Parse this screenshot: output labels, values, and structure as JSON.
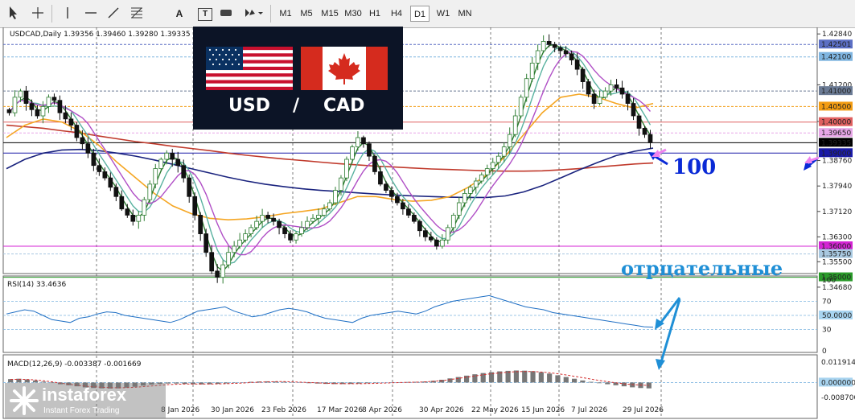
{
  "toolbar": {
    "tools": [
      "cursor-icon",
      "crosshair-icon",
      "vertical-line-icon",
      "horizontal-line-icon",
      "trendline-icon",
      "fibonacci-icon",
      "text-icon",
      "label-icon",
      "shapes-icon",
      "arrows-icon"
    ],
    "text_tool_label": "A",
    "label_tool_label": "T",
    "timeframes": [
      "M1",
      "M5",
      "M15",
      "M30",
      "H1",
      "H4",
      "D1",
      "W1",
      "MN"
    ],
    "active_timeframe": "D1"
  },
  "banner": {
    "base": "USD",
    "separator": "/",
    "quote": "CAD"
  },
  "annotations": {
    "ma_label": "100",
    "rsi_note": "отрцательные"
  },
  "logo": {
    "name": "instaforex",
    "tagline": "Instant Forex Trading"
  },
  "colors": {
    "bull": "#2e7d32",
    "bear": "#111111",
    "accent_blue": "#1f8fd6",
    "arrow_blue": "#0a2ad6",
    "arrow_pink": "#ee82ee"
  },
  "chart_data": [
    {
      "type": "candlestick",
      "title": "USDCAD,Daily  1.39356 1.39460 1.39280 1.39335",
      "symbol": "USDCAD,Daily",
      "last_ohlc": {
        "open": 1.39356,
        "high": 1.3946,
        "low": 1.3928,
        "close": 1.39335
      },
      "ylim": [
        1.346,
        1.43
      ],
      "y_ticks": [
        "1.42840",
        "1.41200",
        "1.40020",
        "1.38760",
        "1.37940",
        "1.37120",
        "1.36300",
        "1.35500",
        "1.34680"
      ],
      "x_tick_labels": [
        "8 Jan 2026",
        "30 Jan 2026",
        "23 Feb 2026",
        "17 Mar 2026",
        "8 Apr 2026",
        "30 Apr 2026",
        "22 May 2026",
        "15 Jun 2026",
        "7 Jul 2026",
        "29 Jul 2026"
      ],
      "horizontal_levels": [
        {
          "price": "1.42501",
          "color": "#5b6fc4"
        },
        {
          "price": "1.42100",
          "color": "#7fb5e0"
        },
        {
          "price": "1.41000",
          "color": "#6b7b95"
        },
        {
          "price": "1.40500",
          "color": "#f39c12"
        },
        {
          "price": "1.40000",
          "color": "#e06060"
        },
        {
          "price": "1.39650",
          "color": "#e7a6e7"
        },
        {
          "price": "1.39335",
          "color": "#000000"
        },
        {
          "price": "1.39000",
          "color": "#1a1aa8"
        },
        {
          "price": "1.36000",
          "color": "#d424d4"
        },
        {
          "price": "1.35750",
          "color": "#a8c8e0"
        },
        {
          "price": "1.35000",
          "color": "#2a9a2a"
        }
      ],
      "close_series": [
        1.403,
        1.408,
        1.41,
        1.406,
        1.404,
        1.402,
        1.405,
        1.408,
        1.407,
        1.403,
        1.401,
        1.399,
        1.395,
        1.393,
        1.39,
        1.386,
        1.384,
        1.382,
        1.379,
        1.376,
        1.372,
        1.37,
        1.368,
        1.37,
        1.375,
        1.38,
        1.385,
        1.388,
        1.39,
        1.388,
        1.386,
        1.382,
        1.376,
        1.37,
        1.364,
        1.358,
        1.352,
        1.35,
        1.354,
        1.358,
        1.36,
        1.362,
        1.364,
        1.366,
        1.368,
        1.37,
        1.369,
        1.368,
        1.366,
        1.364,
        1.362,
        1.364,
        1.366,
        1.368,
        1.369,
        1.37,
        1.372,
        1.374,
        1.378,
        1.382,
        1.388,
        1.392,
        1.395,
        1.393,
        1.389,
        1.384,
        1.38,
        1.378,
        1.376,
        1.374,
        1.372,
        1.37,
        1.368,
        1.365,
        1.363,
        1.362,
        1.36,
        1.362,
        1.366,
        1.37,
        1.374,
        1.377,
        1.379,
        1.381,
        1.383,
        1.385,
        1.387,
        1.389,
        1.392,
        1.396,
        1.402,
        1.408,
        1.414,
        1.419,
        1.423,
        1.426,
        1.425,
        1.424,
        1.423,
        1.422,
        1.42,
        1.417,
        1.413,
        1.409,
        1.406,
        1.408,
        1.41,
        1.412,
        1.411,
        1.409,
        1.406,
        1.402,
        1.398,
        1.396,
        1.3934
      ],
      "moving_averages": [
        {
          "name": "MA200",
          "color": "#c0392b",
          "values": [
            1.399,
            1.3985,
            1.398,
            1.3972,
            1.3965,
            1.3955,
            1.3946,
            1.3937,
            1.393,
            1.3922,
            1.3915,
            1.3908,
            1.39,
            1.3893,
            1.3887,
            1.3881,
            1.3876,
            1.3871,
            1.3866,
            1.3862,
            1.3858,
            1.3855,
            1.3852,
            1.3849,
            1.3847,
            1.3845,
            1.3843,
            1.3842,
            1.3842,
            1.3843,
            1.3846,
            1.385,
            1.3855,
            1.386,
            1.3865,
            1.3868
          ]
        },
        {
          "name": "MA100",
          "color": "#1a237e",
          "values": [
            1.385,
            1.388,
            1.39,
            1.391,
            1.3912,
            1.3908,
            1.39,
            1.389,
            1.3878,
            1.3864,
            1.385,
            1.3836,
            1.3822,
            1.381,
            1.38,
            1.3792,
            1.3785,
            1.378,
            1.3776,
            1.3772,
            1.3768,
            1.3765,
            1.3762,
            1.376,
            1.3758,
            1.3757,
            1.3757,
            1.3762,
            1.3775,
            1.3795,
            1.382,
            1.3846,
            1.387,
            1.3892,
            1.3906,
            1.3916
          ]
        },
        {
          "name": "MA50",
          "color": "#f5a623",
          "values": [
            1.395,
            1.399,
            1.401,
            1.4,
            1.397,
            1.3925,
            1.387,
            1.382,
            1.377,
            1.373,
            1.3705,
            1.369,
            1.3685,
            1.3688,
            1.3695,
            1.3705,
            1.3712,
            1.372,
            1.374,
            1.376,
            1.376,
            1.375,
            1.3745,
            1.3748,
            1.376,
            1.379,
            1.383,
            1.389,
            1.396,
            1.403,
            1.408,
            1.409,
            1.408,
            1.406,
            1.4045,
            1.406
          ]
        }
      ]
    },
    {
      "type": "line",
      "title": "RSI(14) 33.4636",
      "name": "RSI(14)",
      "last_value": 33.4636,
      "ylim": [
        0,
        100
      ],
      "y_ticks": [
        "100",
        "70",
        "50.0000",
        "30",
        "0"
      ],
      "levels": [
        70,
        50,
        30
      ],
      "values": [
        52,
        55,
        58,
        56,
        50,
        44,
        42,
        40,
        46,
        48,
        52,
        55,
        54,
        50,
        48,
        46,
        44,
        42,
        40,
        44,
        50,
        56,
        58,
        60,
        62,
        56,
        52,
        48,
        50,
        54,
        58,
        60,
        58,
        55,
        50,
        46,
        44,
        42,
        40,
        46,
        50,
        52,
        54,
        56,
        54,
        52,
        56,
        62,
        66,
        70,
        72,
        74,
        76,
        78,
        74,
        70,
        66,
        62,
        60,
        58,
        54,
        52,
        50,
        48,
        46,
        44,
        42,
        40,
        38,
        36,
        34,
        33.46
      ]
    },
    {
      "type": "bar",
      "title": "MACD(12,26,9) -0.003387 -0.001669",
      "name": "MACD(12,26,9)",
      "macd": -0.003387,
      "signal": -0.001669,
      "ylim": [
        -0.0087,
        0.0119
      ],
      "y_ticks": [
        "0.011914",
        "0.000000",
        "-0.008700"
      ],
      "histogram": [
        0.002,
        0.0022,
        0.0018,
        0.0012,
        0.0005,
        -0.0003,
        -0.001,
        -0.0016,
        -0.0022,
        -0.0028,
        -0.0032,
        -0.0034,
        -0.0035,
        -0.0034,
        -0.003,
        -0.0025,
        -0.0018,
        -0.0012,
        -0.0008,
        -0.0006,
        -0.0006,
        -0.0008,
        -0.001,
        -0.0011,
        -0.001,
        -0.0008,
        -0.0005,
        -0.0002,
        0.0001,
        0.0004,
        0.0006,
        0.0007,
        0.0006,
        0.0004,
        0.0002,
        -0.0001,
        -0.0004,
        -0.0006,
        -0.0008,
        -0.0009,
        -0.0009,
        -0.0008,
        -0.0006,
        -0.0004,
        -0.0002,
        0.0,
        0.0001,
        0.0002,
        0.0003,
        0.0004,
        0.0006,
        0.001,
        0.0016,
        0.0024,
        0.0032,
        0.004,
        0.0048,
        0.0055,
        0.006,
        0.0065,
        0.0068,
        0.007,
        0.0069,
        0.0066,
        0.006,
        0.0052,
        0.0042,
        0.0032,
        0.0022,
        0.0012,
        0.0004,
        -0.0004,
        -0.001,
        -0.0016,
        -0.0022,
        -0.0028,
        -0.0032,
        -0.0034
      ],
      "signal_line": [
        0.0018,
        0.0019,
        0.0018,
        0.0015,
        0.001,
        0.0004,
        -0.0003,
        -0.001,
        -0.0016,
        -0.0021,
        -0.0025,
        -0.0028,
        -0.003,
        -0.0031,
        -0.003,
        -0.0028,
        -0.0024,
        -0.002,
        -0.0016,
        -0.0012,
        -0.001,
        -0.0009,
        -0.0009,
        -0.0009,
        -0.0009,
        -0.0008,
        -0.0007,
        -0.0005,
        -0.0003,
        0.0,
        0.0002,
        0.0004,
        0.0005,
        0.0005,
        0.0004,
        0.0002,
        0.0,
        -0.0002,
        -0.0004,
        -0.0006,
        -0.0007,
        -0.0007,
        -0.0007,
        -0.0006,
        -0.0005,
        -0.0003,
        -0.0002,
        0.0,
        0.0001,
        0.0002,
        0.0004,
        0.0007,
        0.0011,
        0.0017,
        0.0024,
        0.0031,
        0.0038,
        0.0045,
        0.0051,
        0.0056,
        0.006,
        0.0063,
        0.0064,
        0.0064,
        0.0061,
        0.0057,
        0.0051,
        0.0044,
        0.0036,
        0.0028,
        0.002,
        0.0012,
        0.0005,
        -0.0002,
        -0.0008,
        -0.0012,
        -0.0015,
        -0.0017
      ]
    }
  ]
}
